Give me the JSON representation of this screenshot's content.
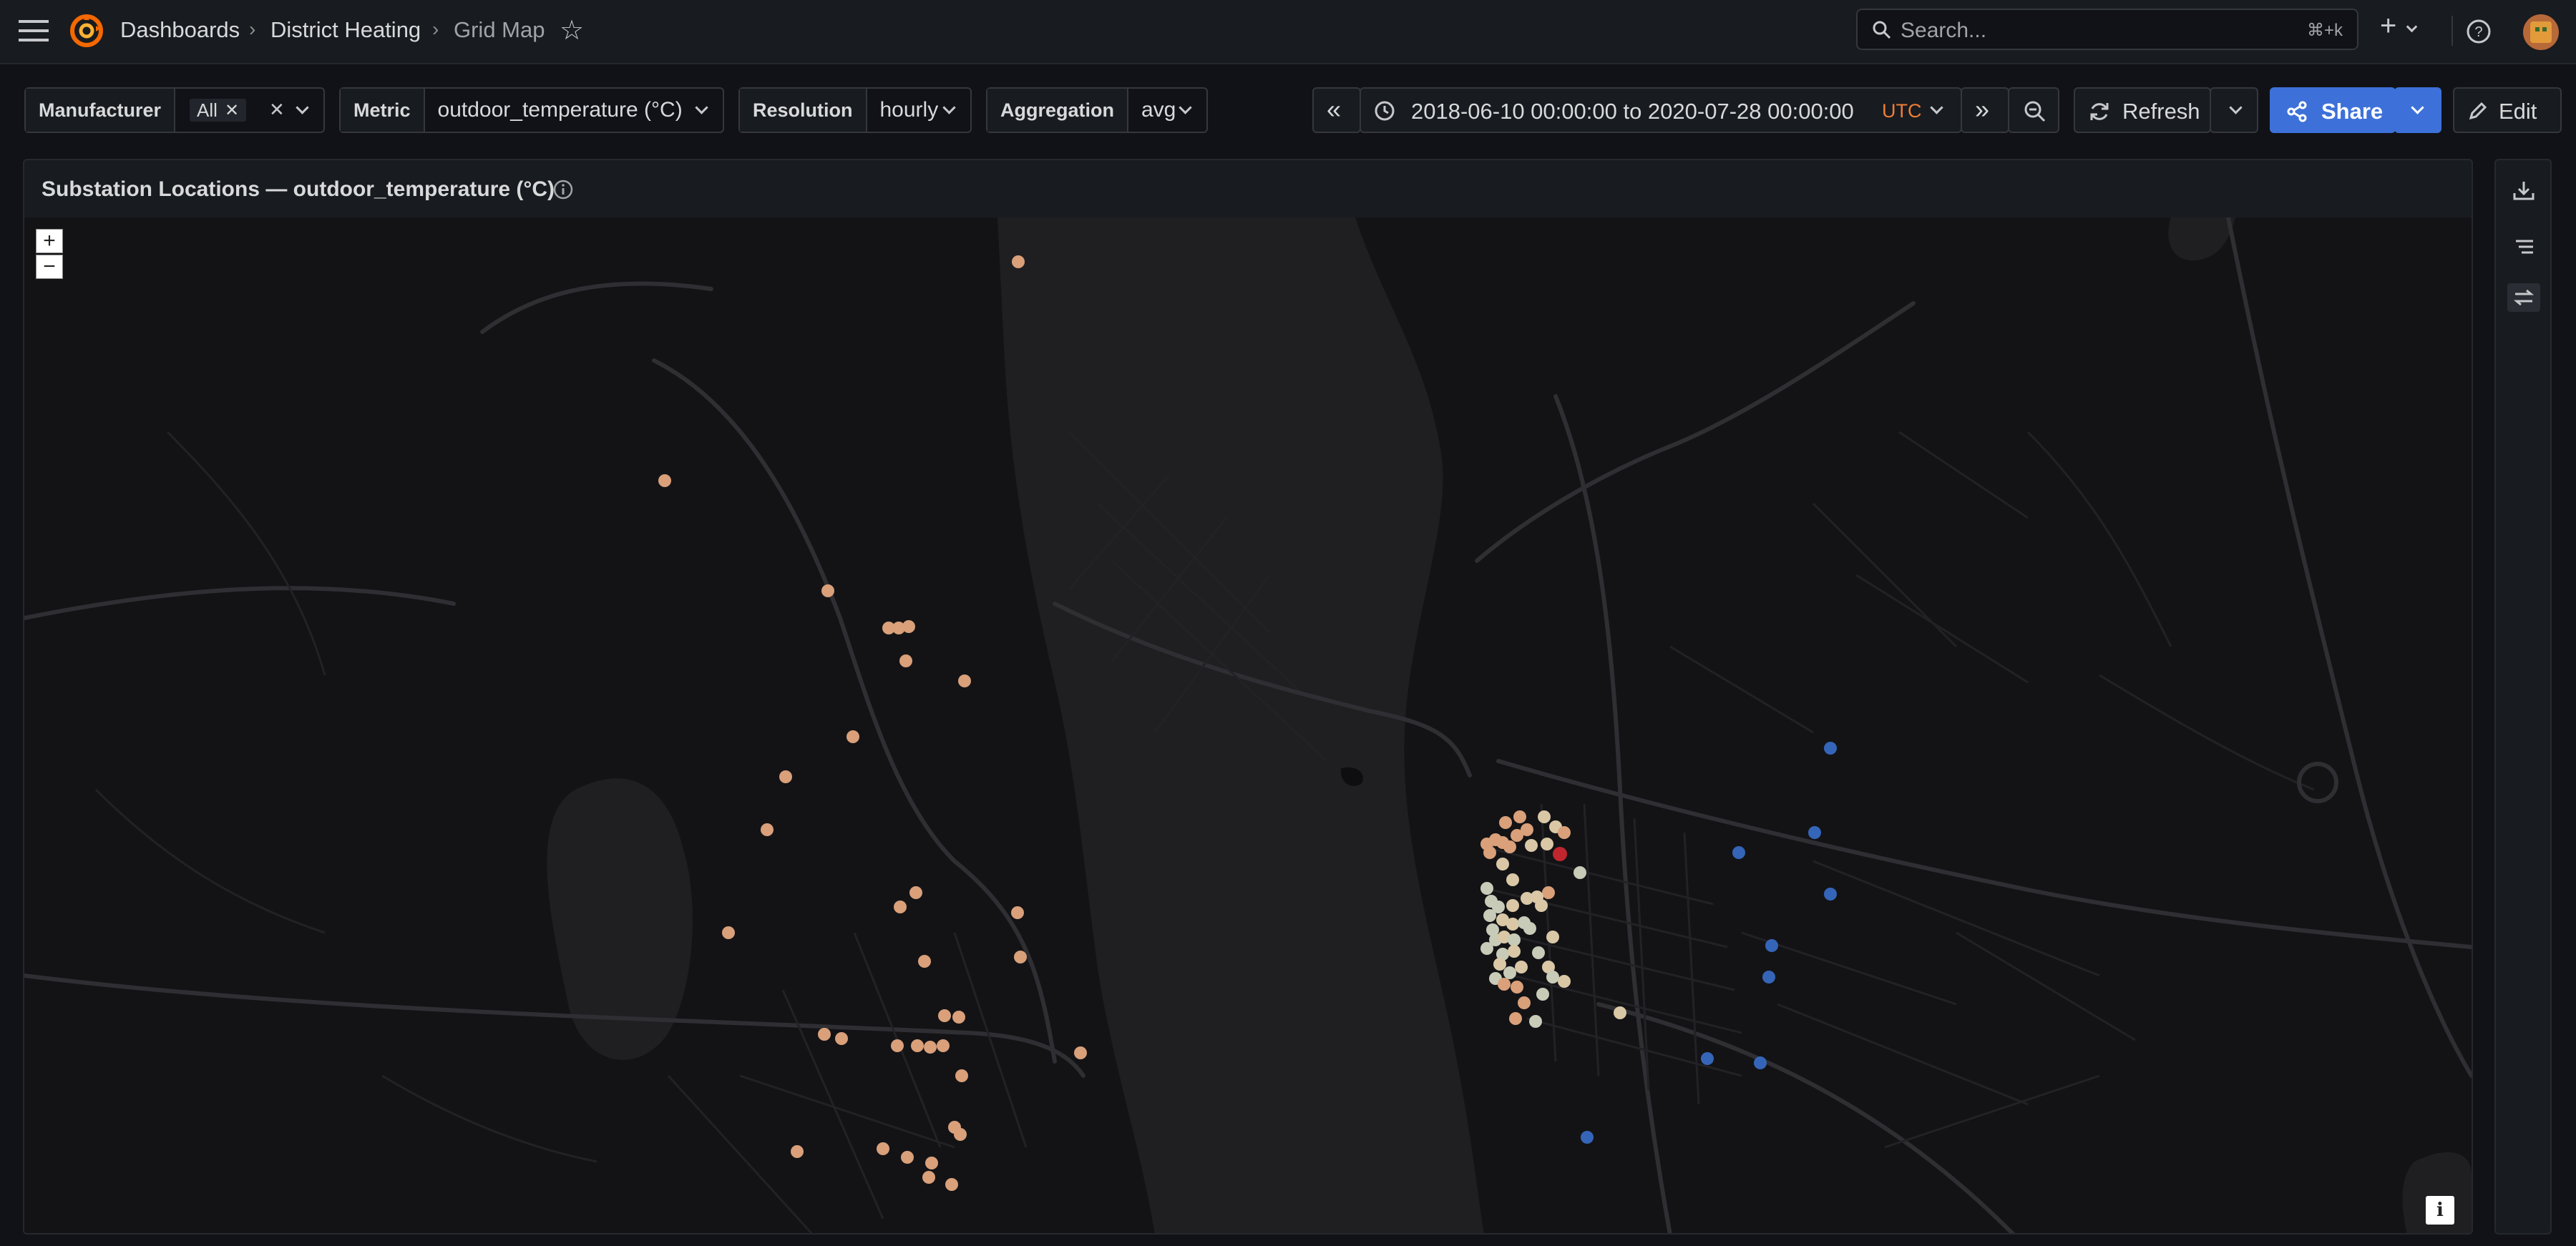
{
  "topbar": {
    "breadcrumb": [
      "Dashboards",
      "District Heating",
      "Grid Map"
    ],
    "search_placeholder": "Search...",
    "search_shortcut": "⌘+k"
  },
  "controls": {
    "manufacturer_label": "Manufacturer",
    "manufacturer_value": "All",
    "metric_label": "Metric",
    "metric_value": "outdoor_temperature (°C)",
    "resolution_label": "Resolution",
    "resolution_value": "hourly",
    "aggregation_label": "Aggregation",
    "aggregation_value": "avg"
  },
  "timerange": {
    "range": "2018-06-10 00:00:00 to 2020-07-28 00:00:00",
    "timezone": "UTC"
  },
  "actions": {
    "refresh_label": "Refresh",
    "share_label": "Share",
    "edit_label": "Edit"
  },
  "panel": {
    "title": "Substation Locations — outdoor_temperature (°C)"
  },
  "map": {
    "zoom_in": "+",
    "zoom_out": "−",
    "attribution": "i",
    "colors": {
      "water": "#1f1f22",
      "land": "#131316",
      "road": "#2a2a2e",
      "warm": "#d9a07a",
      "light": "#d9c7a6",
      "pale": "#c7cbb8",
      "cold": "#3565b8",
      "hot": "#c0262d"
    }
  }
}
